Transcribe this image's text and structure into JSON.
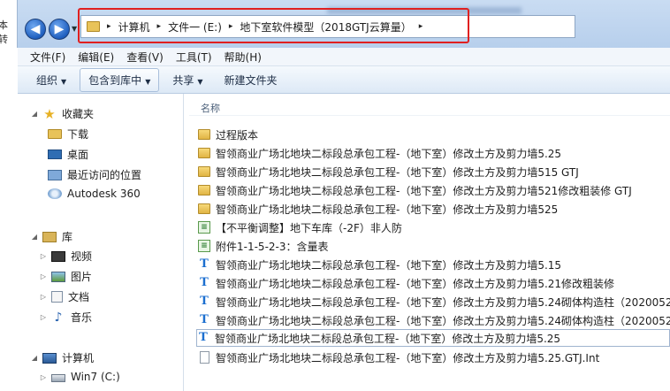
{
  "window": {
    "left_stub_text": "本转",
    "nav_back_glyph": "◀",
    "nav_forward_glyph": "▶"
  },
  "address_bar": {
    "crumbs": [
      "计算机",
      "文件一 (E:)",
      "地下室软件模型（2018GTJ云算量）"
    ],
    "separator": "▸"
  },
  "menu": [
    "文件(F)",
    "编辑(E)",
    "查看(V)",
    "工具(T)",
    "帮助(H)"
  ],
  "toolbar": {
    "organize": "组织",
    "include_in_library": "包含到库中",
    "share": "共享",
    "new_folder": "新建文件夹"
  },
  "nav_pane": {
    "favorites": "收藏夹",
    "favorites_items": [
      "下载",
      "桌面",
      "最近访问的位置",
      "Autodesk 360"
    ],
    "libraries": "库",
    "library_items": [
      "视频",
      "图片",
      "文档",
      "音乐"
    ],
    "computer": "计算机",
    "computer_items": [
      "Win7 (C:)"
    ]
  },
  "file_list": {
    "column_name": "名称",
    "items": [
      {
        "type": "folder",
        "name": "过程版本"
      },
      {
        "type": "folder",
        "name": "智领商业广场北地块二标段总承包工程-（地下室）修改土方及剪力墙5.25"
      },
      {
        "type": "folder",
        "name": "智领商业广场北地块二标段总承包工程-（地下室）修改土方及剪力墙515 GTJ"
      },
      {
        "type": "folder",
        "name": "智领商业广场北地块二标段总承包工程-（地下室）修改土方及剪力墙521修改粗装修 GTJ"
      },
      {
        "type": "folder",
        "name": "智领商业广场北地块二标段总承包工程-（地下室）修改土方及剪力墙525"
      },
      {
        "type": "sheet",
        "name": "【不平衡调整】地下车库（-2F）非人防"
      },
      {
        "type": "sheet",
        "name": "附件1-1-5-2-3：含量表"
      },
      {
        "type": "gtj",
        "name": "智领商业广场北地块二标段总承包工程-（地下室）修改土方及剪力墙5.15"
      },
      {
        "type": "gtj",
        "name": "智领商业广场北地块二标段总承包工程-（地下室）修改土方及剪力墙5.21修改粗装修"
      },
      {
        "type": "gtj",
        "name": "智领商业广场北地块二标段总承包工程-（地下室）修改土方及剪力墙5.24砌体构造柱（2020052"
      },
      {
        "type": "gtj",
        "name": "智领商业广场北地块二标段总承包工程-（地下室）修改土方及剪力墙5.24砌体构造柱（2020052"
      },
      {
        "type": "gtj",
        "name": "智领商业广场北地块二标段总承包工程-（地下室）修改土方及剪力墙5.25"
      },
      {
        "type": "blank",
        "name": "智领商业广场北地块二标段总承包工程-（地下室）修改土方及剪力墙5.25.GTJ.Int"
      }
    ],
    "icon_glyphs": {
      "gtj": "T",
      "sheet": "≡"
    }
  },
  "colors": {
    "highlight_box": "#e02020",
    "toolbar_bg": "#dde9f6",
    "title_bg": "#c9dcf2"
  }
}
